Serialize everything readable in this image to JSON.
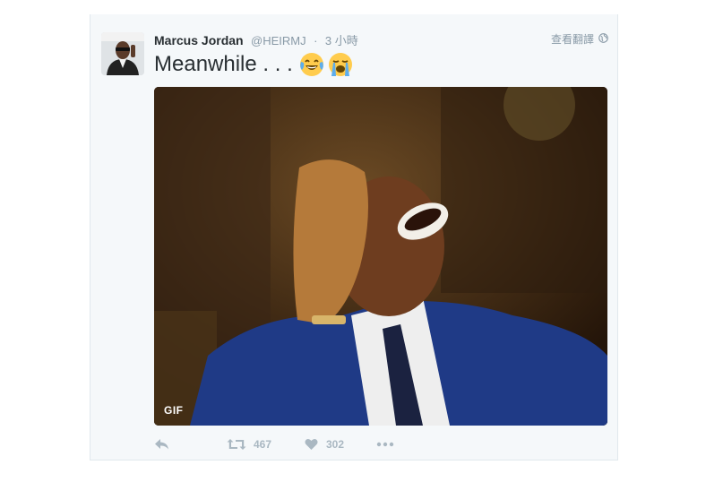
{
  "tweet": {
    "author_name": "Marcus Jordan",
    "author_handle": "@HEIRMJ",
    "separator": "·",
    "timestamp": "3 小時",
    "translate_label": "查看翻譯",
    "text": "Meanwhile . . .",
    "emojis": [
      "face-with-tears-of-joy",
      "loudly-crying-face"
    ],
    "media": {
      "type": "gif",
      "badge": "GIF"
    },
    "actions": {
      "retweet_count": "467",
      "like_count": "302"
    }
  },
  "colors": {
    "card_background": "#f5f8fa",
    "name_text": "#292f33",
    "muted_text": "#8899a6",
    "action_icon": "#aab8c2",
    "suit_blue": "#1f3a86"
  }
}
